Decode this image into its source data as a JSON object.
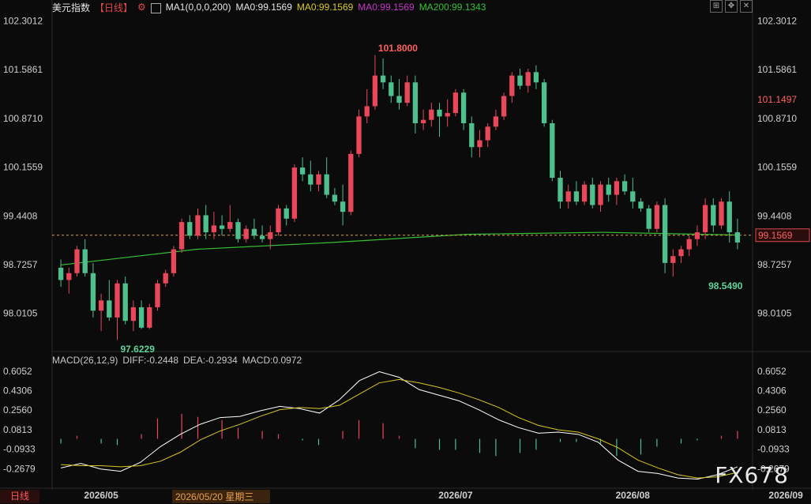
{
  "header": {
    "name": "美元指数",
    "period": "【日线】",
    "ma1": "MA1(0,0,0,200)",
    "ma_label": "MA0:99.1569",
    "ma0_y": "MA0:99.1569",
    "ma0_m": "MA0:99.1569",
    "ma200": "MA200:99.1343"
  },
  "macd_header": {
    "title": "MACD(26,12,9)",
    "diff": "DIFF:-0.2448",
    "dea": "DEA:-0.2934",
    "macd": "MACD:0.0972"
  },
  "bottom": {
    "tab": "日线",
    "crosshair_date": "2026/05/20 星期三",
    "watermark": "FX678"
  },
  "colors": {
    "up": "#e8485a",
    "down": "#4fbf8e",
    "ma200": "#34c234",
    "dif": "#ffffff",
    "dea": "#d8c824"
  },
  "chart_data": {
    "type": "candlestick",
    "price_ticks": [
      "102.3012",
      "101.5861",
      "100.8710",
      "100.1559",
      "99.4408",
      "98.7257",
      "98.0105"
    ],
    "price_tick_values": [
      102.3012,
      101.5861,
      100.871,
      100.1559,
      99.4408,
      98.7257,
      98.0105
    ],
    "price_range": [
      97.45,
      102.4
    ],
    "macd_ticks": [
      "0.6052",
      "0.4306",
      "0.2560",
      "0.0813",
      "-0.0933",
      "-0.2679"
    ],
    "macd_tick_values": [
      0.6052,
      0.4306,
      0.256,
      0.0813,
      -0.0933,
      -0.2679
    ],
    "macd_range": [
      -0.42,
      0.66
    ],
    "x_ticks": [
      {
        "label": "2026/05",
        "i": 5
      },
      {
        "label": "2026/07",
        "i": 49
      },
      {
        "label": "2026/08",
        "i": 71
      },
      {
        "label": "2026/09",
        "i": 90
      }
    ],
    "current_price": "99.1569",
    "current_value": 99.1569,
    "prev_high_label": "101.1497",
    "prev_high_value": 101.1497,
    "annotations": [
      {
        "text": "101.8000",
        "i": 39,
        "value": 101.8
      },
      {
        "text": "97.6229",
        "i": 7,
        "value": 97.6229
      },
      {
        "text": "98.5490",
        "i": 80,
        "value": 98.549
      }
    ],
    "ohlc": [
      [
        98.68,
        98.8,
        98.4,
        98.5
      ],
      [
        98.5,
        98.68,
        98.3,
        98.6
      ],
      [
        98.6,
        99.0,
        98.55,
        98.95
      ],
      [
        98.95,
        99.1,
        98.55,
        98.6
      ],
      [
        98.6,
        98.75,
        97.95,
        98.05
      ],
      [
        98.05,
        98.3,
        97.75,
        98.2
      ],
      [
        98.2,
        98.5,
        97.9,
        97.95
      ],
      [
        97.95,
        98.5,
        97.62,
        98.45
      ],
      [
        98.45,
        98.55,
        97.85,
        97.9
      ],
      [
        97.9,
        98.2,
        97.75,
        98.1
      ],
      [
        98.1,
        98.2,
        97.78,
        97.8
      ],
      [
        97.8,
        98.15,
        97.78,
        98.1
      ],
      [
        98.1,
        98.5,
        98.05,
        98.45
      ],
      [
        98.45,
        98.65,
        98.4,
        98.6
      ],
      [
        98.6,
        99.0,
        98.55,
        98.95
      ],
      [
        98.95,
        99.4,
        98.9,
        99.35
      ],
      [
        99.35,
        99.45,
        99.1,
        99.15
      ],
      [
        99.15,
        99.55,
        99.1,
        99.45
      ],
      [
        99.45,
        99.6,
        99.1,
        99.2
      ],
      [
        99.2,
        99.5,
        99.1,
        99.3
      ],
      [
        99.3,
        99.45,
        99.15,
        99.25
      ],
      [
        99.25,
        99.6,
        99.2,
        99.35
      ],
      [
        99.35,
        99.4,
        99.05,
        99.1
      ],
      [
        99.1,
        99.3,
        99.05,
        99.25
      ],
      [
        99.25,
        99.4,
        99.1,
        99.15
      ],
      [
        99.15,
        99.3,
        99.05,
        99.1
      ],
      [
        99.1,
        99.3,
        98.95,
        99.2
      ],
      [
        99.2,
        99.6,
        99.15,
        99.55
      ],
      [
        99.55,
        99.6,
        99.3,
        99.4
      ],
      [
        99.4,
        100.2,
        99.35,
        100.15
      ],
      [
        100.15,
        100.3,
        99.95,
        100.05
      ],
      [
        100.05,
        100.25,
        99.8,
        99.9
      ],
      [
        99.9,
        100.1,
        99.8,
        100.05
      ],
      [
        100.05,
        100.3,
        99.7,
        99.75
      ],
      [
        99.75,
        99.85,
        99.6,
        99.65
      ],
      [
        99.65,
        99.9,
        99.3,
        99.5
      ],
      [
        99.5,
        100.4,
        99.45,
        100.35
      ],
      [
        100.35,
        101.0,
        100.3,
        100.9
      ],
      [
        100.9,
        101.3,
        100.8,
        101.05
      ],
      [
        101.05,
        101.8,
        101.0,
        101.5
      ],
      [
        101.5,
        101.75,
        101.3,
        101.4
      ],
      [
        101.4,
        101.5,
        101.1,
        101.2
      ],
      [
        101.2,
        101.45,
        101.0,
        101.1
      ],
      [
        101.1,
        101.5,
        101.05,
        101.4
      ],
      [
        101.4,
        101.5,
        100.65,
        100.8
      ],
      [
        100.8,
        101.0,
        100.7,
        100.85
      ],
      [
        100.85,
        101.1,
        100.75,
        101.0
      ],
      [
        101.0,
        101.1,
        100.6,
        100.9
      ],
      [
        100.9,
        101.15,
        100.75,
        100.95
      ],
      [
        100.95,
        101.3,
        100.9,
        101.25
      ],
      [
        101.25,
        101.3,
        100.7,
        100.8
      ],
      [
        100.8,
        100.9,
        100.3,
        100.45
      ],
      [
        100.45,
        100.7,
        100.3,
        100.55
      ],
      [
        100.55,
        100.8,
        100.45,
        100.75
      ],
      [
        100.75,
        101.0,
        100.7,
        100.9
      ],
      [
        100.9,
        101.25,
        100.85,
        101.2
      ],
      [
        101.2,
        101.55,
        101.1,
        101.5
      ],
      [
        101.5,
        101.6,
        101.3,
        101.35
      ],
      [
        101.35,
        101.6,
        101.25,
        101.55
      ],
      [
        101.55,
        101.65,
        101.3,
        101.4
      ],
      [
        101.4,
        101.45,
        100.75,
        100.8
      ],
      [
        100.8,
        100.85,
        99.95,
        100.0
      ],
      [
        100.0,
        100.1,
        99.55,
        99.65
      ],
      [
        99.65,
        99.9,
        99.55,
        99.8
      ],
      [
        99.8,
        99.95,
        99.6,
        99.65
      ],
      [
        99.65,
        99.95,
        99.6,
        99.9
      ],
      [
        99.9,
        100.0,
        99.55,
        99.6
      ],
      [
        99.6,
        99.95,
        99.5,
        99.9
      ],
      [
        99.9,
        100.0,
        99.65,
        99.75
      ],
      [
        99.75,
        100.0,
        99.6,
        99.95
      ],
      [
        99.95,
        100.05,
        99.75,
        99.8
      ],
      [
        99.8,
        100.0,
        99.55,
        99.65
      ],
      [
        99.65,
        99.7,
        99.5,
        99.55
      ],
      [
        99.55,
        99.6,
        99.2,
        99.25
      ],
      [
        99.25,
        99.65,
        99.2,
        99.6
      ],
      [
        99.6,
        99.7,
        98.6,
        98.75
      ],
      [
        98.75,
        98.95,
        98.55,
        98.85
      ],
      [
        98.85,
        99.0,
        98.75,
        98.95
      ],
      [
        98.95,
        99.15,
        98.85,
        99.1
      ],
      [
        99.1,
        99.3,
        99.0,
        99.2
      ],
      [
        99.2,
        99.7,
        99.1,
        99.6
      ],
      [
        99.6,
        99.7,
        99.2,
        99.3
      ],
      [
        99.3,
        99.7,
        99.25,
        99.65
      ],
      [
        99.65,
        99.8,
        99.05,
        99.2
      ],
      [
        99.2,
        99.4,
        98.95,
        99.05
      ]
    ],
    "ma200": [
      98.72,
      98.95,
      99.05,
      99.17,
      99.2,
      99.16
    ],
    "dif": [
      -0.26,
      -0.22,
      -0.27,
      -0.29,
      -0.21,
      -0.07,
      0.04,
      0.13,
      0.19,
      0.2,
      0.25,
      0.29,
      0.27,
      0.23,
      0.35,
      0.52,
      0.6,
      0.55,
      0.44,
      0.39,
      0.34,
      0.26,
      0.17,
      0.1,
      0.05,
      0.06,
      0.04,
      -0.03,
      -0.19,
      -0.29,
      -0.31,
      -0.35,
      -0.36,
      -0.32,
      -0.25
    ],
    "dea": [
      -0.23,
      -0.24,
      -0.24,
      -0.25,
      -0.24,
      -0.2,
      -0.12,
      -0.01,
      0.07,
      0.13,
      0.2,
      0.26,
      0.28,
      0.27,
      0.3,
      0.4,
      0.5,
      0.53,
      0.5,
      0.46,
      0.41,
      0.35,
      0.28,
      0.19,
      0.12,
      0.08,
      0.06,
      0.0,
      -0.08,
      -0.19,
      -0.26,
      -0.32,
      -0.35,
      -0.34,
      -0.3
    ]
  }
}
